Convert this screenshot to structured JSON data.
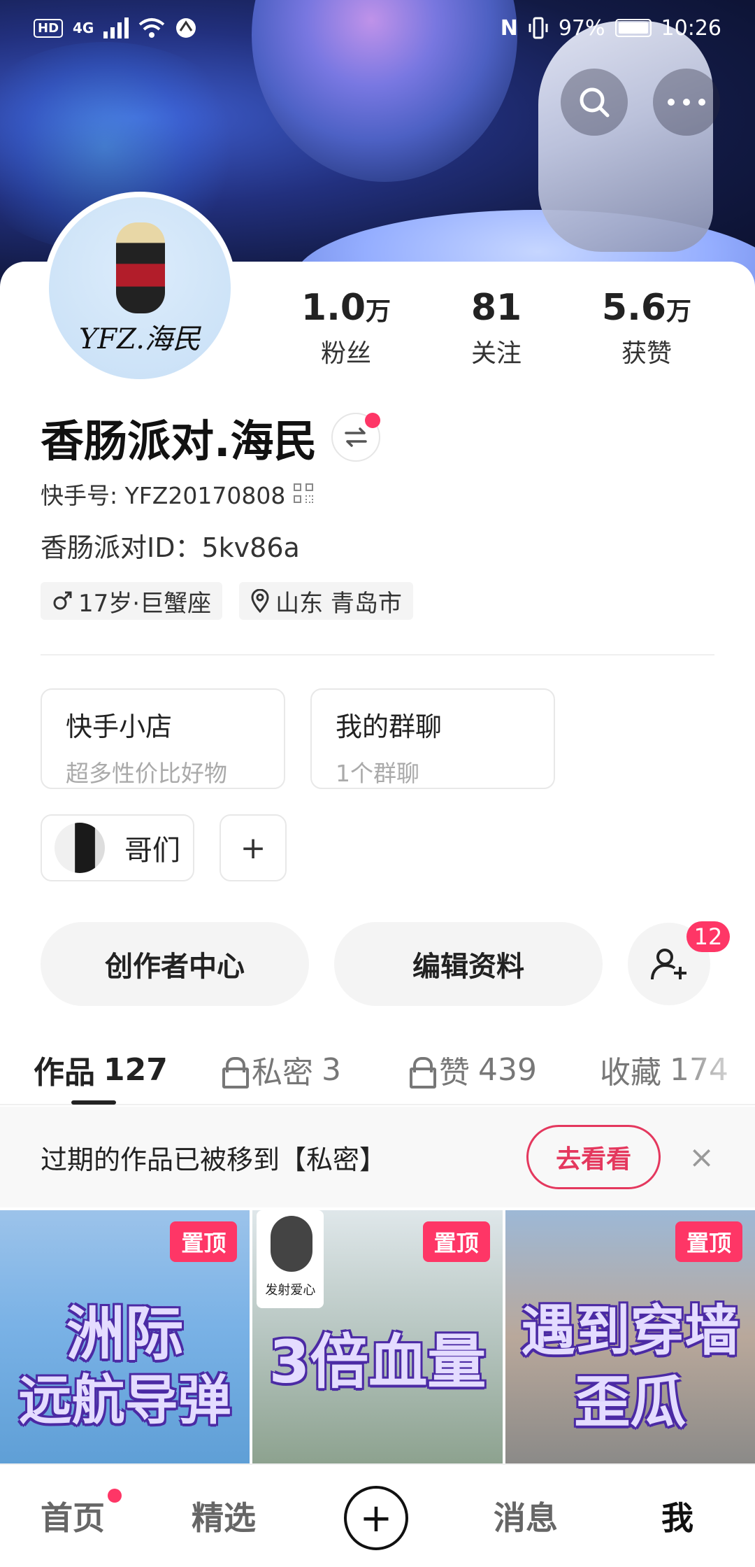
{
  "status": {
    "left": [
      "HD",
      "4G",
      "signal",
      "wifi",
      "data"
    ],
    "nfc": "N",
    "battery": "97%",
    "time": "10:26"
  },
  "profile": {
    "avatar_text": "YFZ.海民",
    "name": "香肠派对.海民",
    "kuaishou_id": "快手号: YFZ20170808",
    "party_id": "香肠派对ID：5kv86a",
    "tags": [
      "17岁·巨蟹座",
      "山东 青岛市"
    ]
  },
  "stats": [
    {
      "num": "1.0",
      "unit": "万",
      "label": "粉丝"
    },
    {
      "num": "81",
      "unit": "",
      "label": "关注"
    },
    {
      "num": "5.6",
      "unit": "万",
      "label": "获赞"
    }
  ],
  "boxes": [
    {
      "title": "快手小店",
      "sub": "超多性价比好物"
    },
    {
      "title": "我的群聊",
      "sub": "1个群聊"
    }
  ],
  "chips": {
    "group_label": "哥们",
    "add_label": "+"
  },
  "actions": {
    "creator": "创作者中心",
    "edit": "编辑资料",
    "friend_badge": "12"
  },
  "tabs": [
    {
      "label": "作品",
      "count": "127"
    },
    {
      "label": "私密",
      "count": "3"
    },
    {
      "label": "赞",
      "count": "439"
    },
    {
      "label": "收藏",
      "count": "174"
    }
  ],
  "notice": {
    "text": "过期的作品已被移到【私密】",
    "button": "去看看",
    "close": "×"
  },
  "videos": [
    {
      "pin": "置顶",
      "line1": "洲际",
      "line2": "远航导弹"
    },
    {
      "pin": "置顶",
      "line1": "3倍血量",
      "meme": "发射爱心"
    },
    {
      "pin": "置顶",
      "line1": "遇到穿墙",
      "line2": "歪瓜"
    }
  ],
  "nav": {
    "home": "首页",
    "featured": "精选",
    "plus": "+",
    "messages": "消息",
    "me": "我"
  }
}
